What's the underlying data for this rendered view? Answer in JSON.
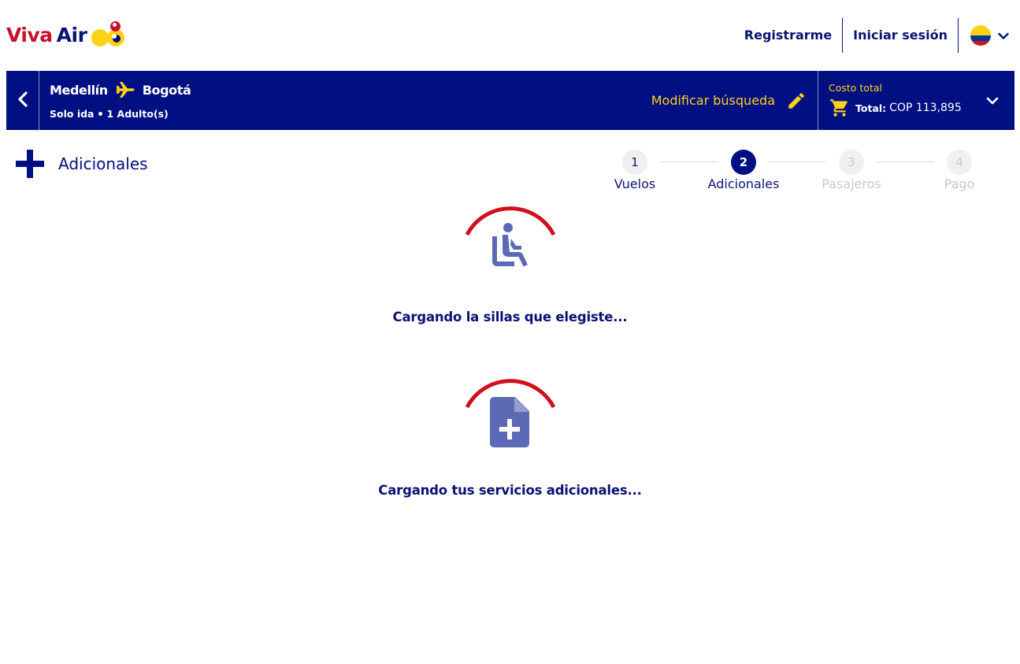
{
  "brand": {
    "name_part1": "Viva",
    "name_part2": "Air"
  },
  "header": {
    "register_label": "Registrarme",
    "login_label": "Iniciar sesión",
    "country_flag_icon": "colombia-flag-icon"
  },
  "search": {
    "origin": "Medellín",
    "destination": "Bogotá",
    "trip_type": "Solo ida",
    "passengers": "1 Adulto(s)",
    "modify_label": "Modificar búsqueda",
    "cost_label": "Costo total",
    "total_label": "Total:",
    "total_value": "COP 113,895"
  },
  "section": {
    "title": "Adicionales",
    "icon": "plus-icon"
  },
  "stepper": {
    "steps": [
      {
        "number": "1",
        "label": "Vuelos",
        "state": "done"
      },
      {
        "number": "2",
        "label": "Adicionales",
        "state": "active"
      },
      {
        "number": "3",
        "label": "Pasajeros",
        "state": "todo"
      },
      {
        "number": "4",
        "label": "Pago",
        "state": "todo"
      }
    ]
  },
  "loaders": [
    {
      "icon": "seat-icon",
      "message": "Cargando la sillas que elegiste..."
    },
    {
      "icon": "document-add-icon",
      "message": "Cargando tus servicios adicionales..."
    }
  ],
  "colors": {
    "brand_blue": "#000f82",
    "brand_red": "#c8102e",
    "brand_yellow": "#fcd116",
    "icon_purple": "#5c6ab5",
    "loader_arc": "#d0101c"
  }
}
